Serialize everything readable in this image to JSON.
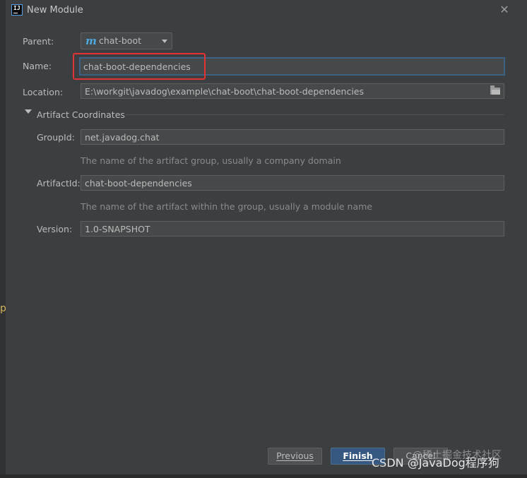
{
  "window": {
    "title": "New Module",
    "close_glyph": "✕"
  },
  "form": {
    "parent": {
      "label": "Parent:",
      "value": "chat-boot",
      "icon": "maven-m-icon"
    },
    "name": {
      "label": "Name:",
      "value": "chat-boot-dependencies"
    },
    "location": {
      "label": "Location:",
      "value": "E:\\workgit\\javadog\\example\\chat-boot\\chat-boot-dependencies"
    }
  },
  "artifact": {
    "section_title": "Artifact Coordinates",
    "group_id": {
      "label": "GroupId:",
      "value": "net.javadog.chat",
      "hint": "The name of the artifact group, usually a company domain"
    },
    "artifact_id": {
      "label": "ArtifactId:",
      "value": "chat-boot-dependencies",
      "hint": "The name of the artifact within the group, usually a module name"
    },
    "version": {
      "label": "Version:",
      "value": "1.0-SNAPSHOT"
    }
  },
  "buttons": {
    "previous_label": "Previous",
    "finish_label": "Finish",
    "cancel_label": "Cancel"
  },
  "watermarks": {
    "juejin": "@稀土掘金技术社区",
    "csdn": "CSDN @JavaDog程序狗"
  },
  "left_edge_char": "p",
  "colors": {
    "dialog_bg": "#3c3f41",
    "field_bg": "#45494a",
    "primary_button": "#365880",
    "highlight_box": "#e23232",
    "focus_border": "#3d6185"
  }
}
